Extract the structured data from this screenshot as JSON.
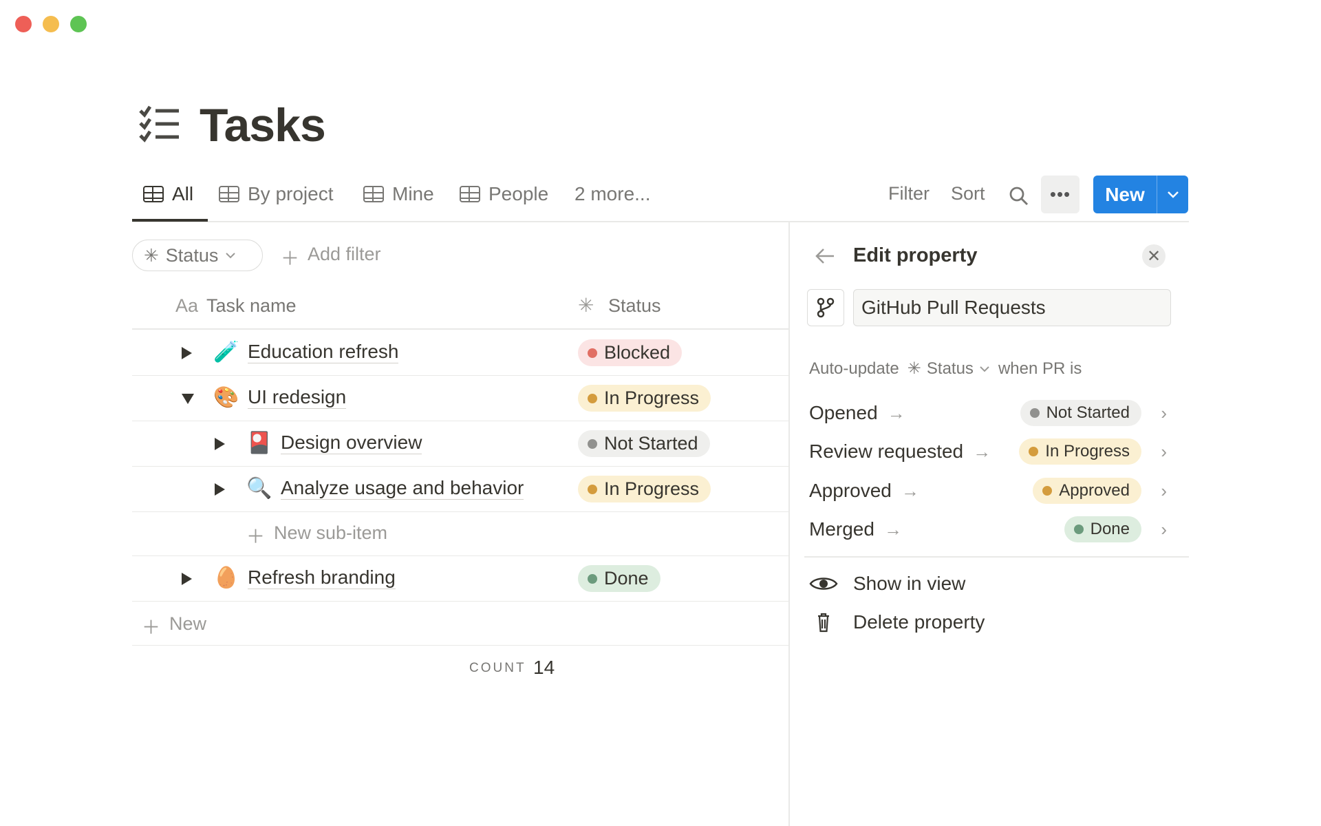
{
  "window": {
    "controls": {
      "close": "#ee5f57",
      "minimize": "#f5bd4f",
      "maximize": "#5ec454"
    }
  },
  "page": {
    "icon": "checklist-icon",
    "title": "Tasks"
  },
  "tabs": [
    {
      "label": "All",
      "active": true
    },
    {
      "label": "By project"
    },
    {
      "label": "Mine"
    },
    {
      "label": "People"
    }
  ],
  "more_tabs": "2 more...",
  "toolbar": {
    "filter": "Filter",
    "sort": "Sort",
    "new_label": "New",
    "accent": "#2383e2"
  },
  "filters": {
    "status_chip": "Status",
    "add_filter": "Add filter"
  },
  "table": {
    "columns": [
      {
        "icon": "Aa",
        "label": "Task name"
      },
      {
        "icon": "status-icon",
        "label": "Status"
      }
    ],
    "rows": [
      {
        "emoji": "🧪",
        "name": "Education refresh",
        "status": "Blocked",
        "expanded": false,
        "level": 0
      },
      {
        "emoji": "🎨",
        "name": "UI redesign",
        "status": "In Progress",
        "expanded": true,
        "level": 0
      },
      {
        "emoji": "🎴",
        "name": "Design overview",
        "status": "Not Started",
        "expanded": false,
        "level": 1
      },
      {
        "emoji": "🔍",
        "name": "Analyze usage and behavior",
        "status": "In Progress",
        "expanded": false,
        "level": 1
      },
      {
        "emoji": "🥚",
        "name": "Refresh branding",
        "status": "Done",
        "expanded": false,
        "level": 0
      }
    ],
    "new_sub_item": "New sub-item",
    "new_row": "New",
    "count_label": "COUNT",
    "count_value": "14"
  },
  "status_colors": {
    "Blocked": {
      "bg": "#fbe4e4",
      "dot": "#e16f64"
    },
    "In Progress": {
      "bg": "#fbf0d2",
      "dot": "#d49c3d"
    },
    "Approved": {
      "bg": "#fbf0d2",
      "dot": "#d49c3d"
    },
    "Not Started": {
      "bg": "#efefed",
      "dot": "#91918e"
    },
    "Done": {
      "bg": "#ddeddf",
      "dot": "#6c9b7d"
    }
  },
  "panel": {
    "title": "Edit property",
    "property_icon": "git-branch-icon",
    "property_name": "GitHub Pull Requests",
    "auto_update": "Auto-update",
    "auto_status": "Status",
    "when_pr": "when PR is",
    "mappings": [
      {
        "event": "Opened",
        "status": "Not Started"
      },
      {
        "event": "Review requested",
        "status": "In Progress"
      },
      {
        "event": "Approved",
        "status": "Approved"
      },
      {
        "event": "Merged",
        "status": "Done"
      }
    ],
    "show_in_view": "Show in view",
    "delete_property": "Delete property"
  }
}
